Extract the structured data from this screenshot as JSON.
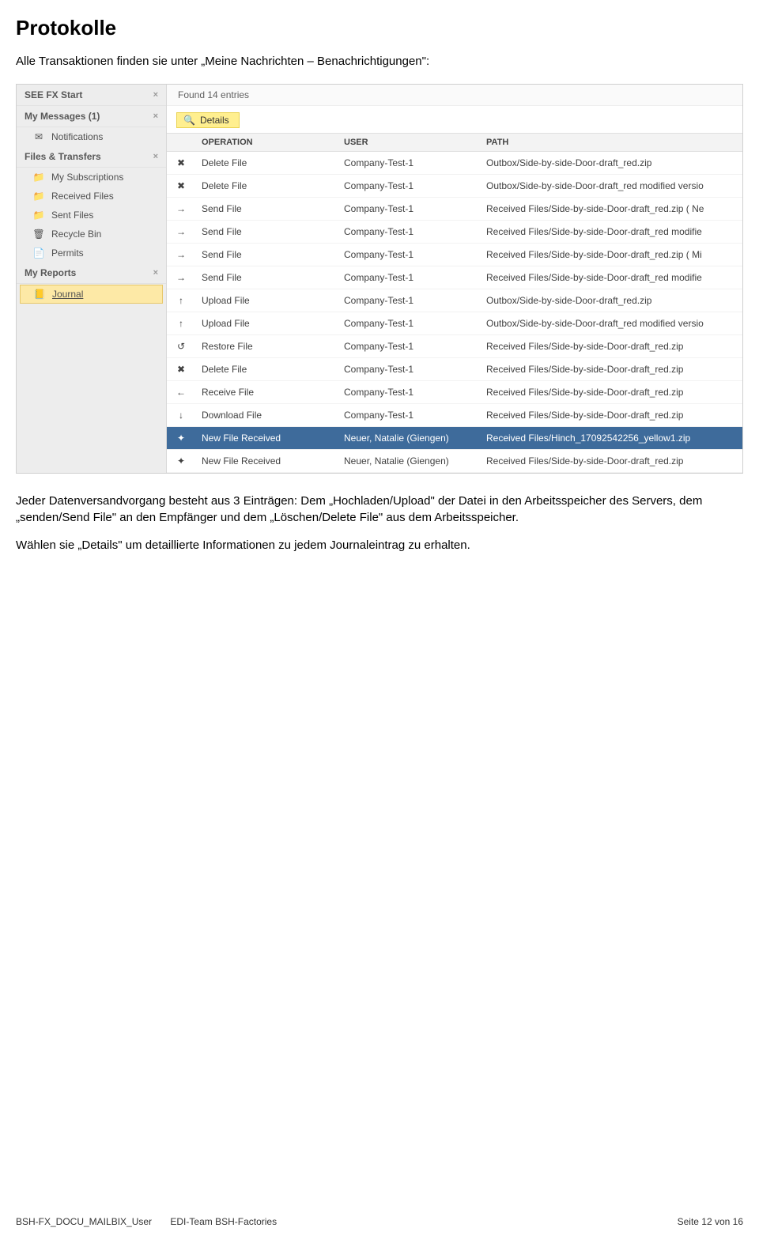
{
  "heading": "Protokolle",
  "intro": "Alle Transaktionen finden sie unter „Meine Nachrichten – Benachrichtigungen\":",
  "sidebar": {
    "sections": [
      {
        "title": "SEE FX Start",
        "closable": true,
        "items": []
      },
      {
        "title": "My Messages (1)",
        "closable": true,
        "items": [
          {
            "label": "Notifications",
            "icon": "envelope-icon",
            "icon_char": "✉"
          }
        ]
      },
      {
        "title": "Files & Transfers",
        "closable": true,
        "items": [
          {
            "label": "My Subscriptions",
            "icon": "folder-icon",
            "icon_char": "📁"
          },
          {
            "label": "Received Files",
            "icon": "folder-down-icon",
            "icon_char": "📁"
          },
          {
            "label": "Sent Files",
            "icon": "folder-up-icon",
            "icon_char": "📁"
          },
          {
            "label": "Recycle Bin",
            "icon": "trash-icon",
            "icon_char": "🗑"
          },
          {
            "label": "Permits",
            "icon": "permit-icon",
            "icon_char": "📄"
          }
        ]
      },
      {
        "title": "My Reports",
        "closable": true,
        "items": [
          {
            "label": "Journal",
            "icon": "journal-icon",
            "icon_char": "📒",
            "selected": true
          }
        ]
      }
    ]
  },
  "main": {
    "found_label": "Found 14 entries",
    "details_button": "Details",
    "columns": {
      "operation": "OPERATION",
      "user": "USER",
      "path": "PATH"
    },
    "rows": [
      {
        "icon": "delete-file-icon",
        "icon_char": "✖",
        "op": "Delete File",
        "user": "Company-Test-1",
        "path": "Outbox/Side-by-side-Door-draft_red.zip"
      },
      {
        "icon": "delete-file-icon",
        "icon_char": "✖",
        "op": "Delete File",
        "user": "Company-Test-1",
        "path": "Outbox/Side-by-side-Door-draft_red modified versio"
      },
      {
        "icon": "send-file-icon",
        "icon_char": "→",
        "op": "Send File",
        "user": "Company-Test-1",
        "path": "Received Files/Side-by-side-Door-draft_red.zip ( Ne"
      },
      {
        "icon": "send-file-icon",
        "icon_char": "→",
        "op": "Send File",
        "user": "Company-Test-1",
        "path": "Received Files/Side-by-side-Door-draft_red modifie"
      },
      {
        "icon": "send-file-icon",
        "icon_char": "→",
        "op": "Send File",
        "user": "Company-Test-1",
        "path": "Received Files/Side-by-side-Door-draft_red.zip ( Mi"
      },
      {
        "icon": "send-file-icon",
        "icon_char": "→",
        "op": "Send File",
        "user": "Company-Test-1",
        "path": "Received Files/Side-by-side-Door-draft_red modifie"
      },
      {
        "icon": "upload-file-icon",
        "icon_char": "↑",
        "op": "Upload File",
        "user": "Company-Test-1",
        "path": "Outbox/Side-by-side-Door-draft_red.zip"
      },
      {
        "icon": "upload-file-icon",
        "icon_char": "↑",
        "op": "Upload File",
        "user": "Company-Test-1",
        "path": "Outbox/Side-by-side-Door-draft_red modified versio"
      },
      {
        "icon": "restore-file-icon",
        "icon_char": "↺",
        "op": "Restore File",
        "user": "Company-Test-1",
        "path": "Received Files/Side-by-side-Door-draft_red.zip"
      },
      {
        "icon": "delete-file-icon",
        "icon_char": "✖",
        "op": "Delete File",
        "user": "Company-Test-1",
        "path": "Received Files/Side-by-side-Door-draft_red.zip"
      },
      {
        "icon": "receive-file-icon",
        "icon_char": "←",
        "op": "Receive File",
        "user": "Company-Test-1",
        "path": "Received Files/Side-by-side-Door-draft_red.zip"
      },
      {
        "icon": "download-file-icon",
        "icon_char": "↓",
        "op": "Download File",
        "user": "Company-Test-1",
        "path": "Received Files/Side-by-side-Door-draft_red.zip"
      },
      {
        "icon": "new-file-icon",
        "icon_char": "✦",
        "op": "New File Received",
        "user": "Neuer, Natalie (Giengen)",
        "path": "Received Files/Hinch_17092542256_yellow1.zip",
        "selected": true
      },
      {
        "icon": "new-file-icon",
        "icon_char": "✦",
        "op": "New File Received",
        "user": "Neuer, Natalie (Giengen)",
        "path": "Received Files/Side-by-side-Door-draft_red.zip"
      }
    ]
  },
  "post_p1": "Jeder Datenversandvorgang besteht aus 3 Einträgen: Dem „Hochladen/Upload\" der Datei in den Arbeitsspeicher des Servers, dem „senden/Send File\" an den Empfänger und dem „Löschen/Delete File\" aus dem Arbeitsspeicher.",
  "post_p2": "Wählen sie „Details\" um detaillierte Informationen zu jedem Journaleintrag zu erhalten.",
  "footer": {
    "doc": "BSH-FX_DOCU_MAILBIX_User",
    "team": "EDI-Team BSH-Factories",
    "page": "Seite 12 von 16"
  }
}
